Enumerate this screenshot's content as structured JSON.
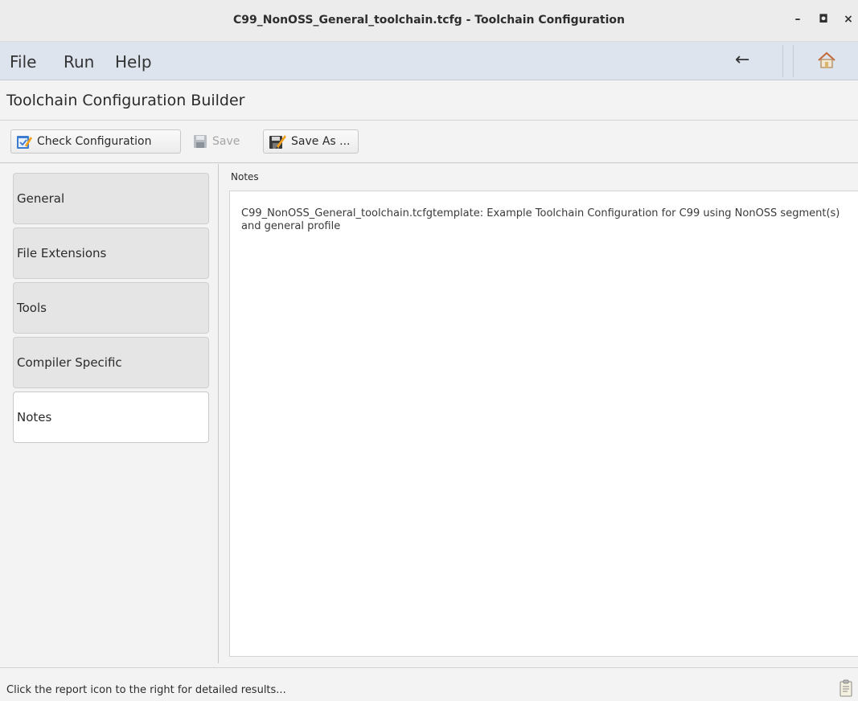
{
  "window": {
    "title": "C99_NonOSS_General_toolchain.tcfg - Toolchain Configuration",
    "minimize_glyph": "–",
    "maximize_glyph": "◘",
    "close_glyph": "×"
  },
  "menubar": {
    "items": [
      "File",
      "Run",
      "Help"
    ],
    "back_glyph": "←",
    "home_icon": "home-icon"
  },
  "header": {
    "title": "Toolchain Configuration Builder"
  },
  "toolbar": {
    "check_label": "Check Configuration",
    "save_label": "Save",
    "save_as_label": "Save As ...",
    "save_enabled": false
  },
  "nav": {
    "items": [
      "General",
      "File Extensions",
      "Tools",
      "Compiler Specific",
      "Notes"
    ],
    "active": "Notes"
  },
  "notes": {
    "section_label": "Notes",
    "text": "C99_NonOSS_General_toolchain.tcfgtemplate: Example Toolchain Configuration for C99 using NonOSS segment(s) and general profile"
  },
  "status": {
    "text": "Click the report icon to the right for detailed results...",
    "report_icon": "clipboard-icon"
  }
}
